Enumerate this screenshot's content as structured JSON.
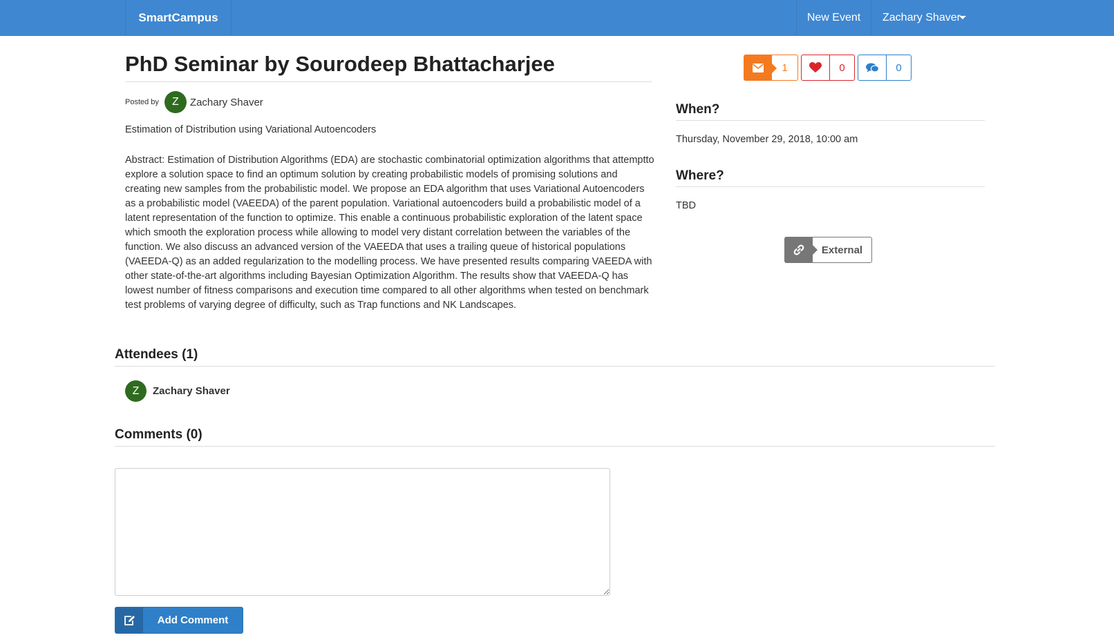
{
  "navbar": {
    "brand": "SmartCampus",
    "new_event": "New Event",
    "user_name": "Zachary Shaver"
  },
  "event": {
    "title": "PhD Seminar by Sourodeep Bhattacharjee",
    "posted_by_label": "Posted by",
    "author_initial": "Z",
    "author_name": "Zachary Shaver",
    "subtitle": "Estimation of Distribution using Variational Autoencoders",
    "abstract": "Abstract: Estimation of Distribution Algorithms (EDA) are stochastic combinatorial optimization algorithms that attemptto explore a solution space to find an optimum solution by creating probabilistic models of promising solutions and creating new samples from the probabilistic model. We propose an EDA algorithm that uses Variational Autoencoders as a probabilistic model (VAEEDA) of the parent population. Variational autoencoders build a probabilistic model of a latent representation of the function to optimize. This enable a continuous probabilistic exploration of the latent space which smooth the exploration process while allowing to model very distant correlation between the variables of the function. We also discuss an advanced version of the VAEEDA that uses a trailing queue of historical populations (VAEEDA-Q) as an added regularization to the modelling process. We have presented results comparing VAEEDA with other state-of-the-art algorithms including Bayesian Optimization Algorithm. The results show that VAEEDA-Q has lowest number of fitness comparisons and execution time compared to all other algorithms when tested on benchmark test problems of varying degree of difficulty, such as Trap functions and NK Landscapes."
  },
  "counters": {
    "mail_count": "1",
    "like_count": "0",
    "comment_count": "0",
    "mail_icon": "envelope-icon",
    "like_icon": "heart-icon",
    "comment_icon": "comments-icon",
    "mail_color": "#f47a20",
    "like_color": "#d9262d",
    "comment_color": "#2f80c9"
  },
  "sidebar": {
    "when_heading": "When?",
    "when_value": "Thursday, November 29, 2018, 10:00 am",
    "where_heading": "Where?",
    "where_value": "TBD",
    "external_label": "External",
    "external_icon": "link-icon"
  },
  "attendees": {
    "heading": "Attendees (1)",
    "items": [
      {
        "initial": "Z",
        "name": "Zachary Shaver"
      }
    ]
  },
  "comments": {
    "heading": "Comments (0)",
    "input_value": "",
    "add_label": "Add Comment",
    "add_icon": "edit-icon"
  },
  "colors": {
    "navbar": "#3f87d1",
    "avatar": "#2e6b1f",
    "primary": "#2f80c9"
  }
}
